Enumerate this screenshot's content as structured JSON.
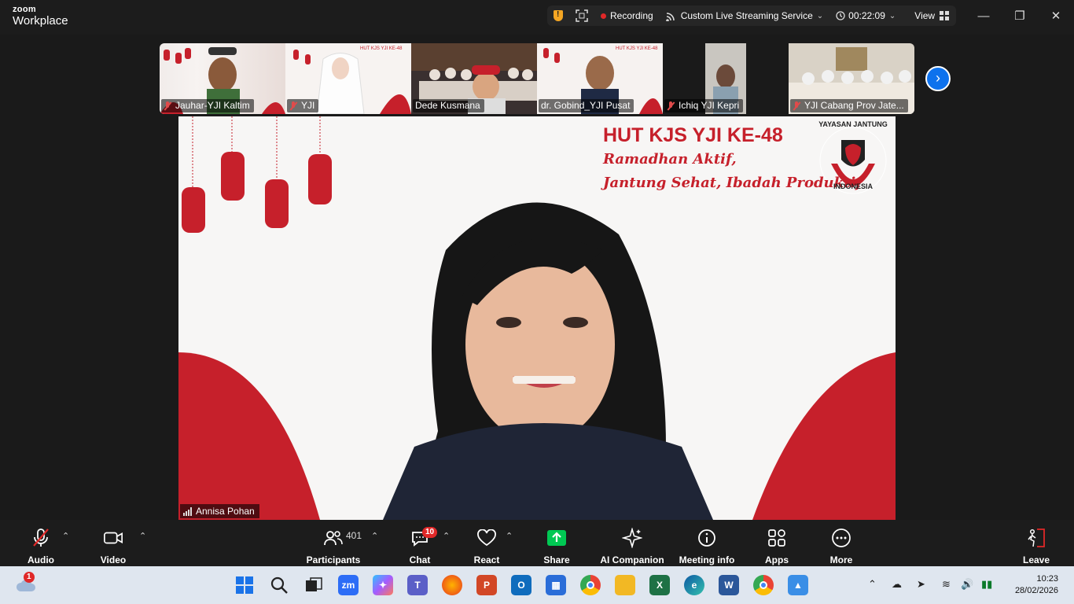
{
  "app": {
    "logo_line1": "zoom",
    "logo_line2": "Workplace"
  },
  "meeting_bar": {
    "recording_label": "Recording",
    "streaming_label": "Custom Live Streaming Service",
    "timer": "00:22:09",
    "view_label": "View"
  },
  "participants_strip": [
    {
      "name": "Jauhar-YJI Kaltim",
      "muted": true
    },
    {
      "name": "YJI",
      "muted": true
    },
    {
      "name": "Dede Kusmana",
      "muted": false
    },
    {
      "name": "dr. Gobind_YJI Pusat",
      "muted": false
    },
    {
      "name": "Ichiq YJI Kepri",
      "muted": true
    },
    {
      "name": "YJI Cabang Prov Jate...",
      "muted": true
    }
  ],
  "main_video": {
    "speaker_name": "Annisa Pohan",
    "banner_title": "HUT KJS YJI KE-48",
    "banner_line1": "Ramadhan Aktif,",
    "banner_line2": "Jantung Sehat, Ibadah Produktif",
    "logo_text_top": "YAYASAN JANTUNG",
    "logo_text_bottom": "INDONESIA"
  },
  "toolbar": {
    "audio": "Audio",
    "video": "Video",
    "participants": "Participants",
    "participants_count": "401",
    "chat": "Chat",
    "chat_badge": "10",
    "react": "React",
    "share": "Share",
    "ai_companion": "AI Companion",
    "meeting_info": "Meeting info",
    "apps": "Apps",
    "more": "More",
    "leave": "Leave"
  },
  "taskbar": {
    "weather_badge": "1",
    "time": "10:23",
    "date": "28/02/2026"
  },
  "colors": {
    "accent": "#0e72ed",
    "record": "#e02828",
    "brand_red": "#c6202b",
    "share_green": "#00c853"
  }
}
